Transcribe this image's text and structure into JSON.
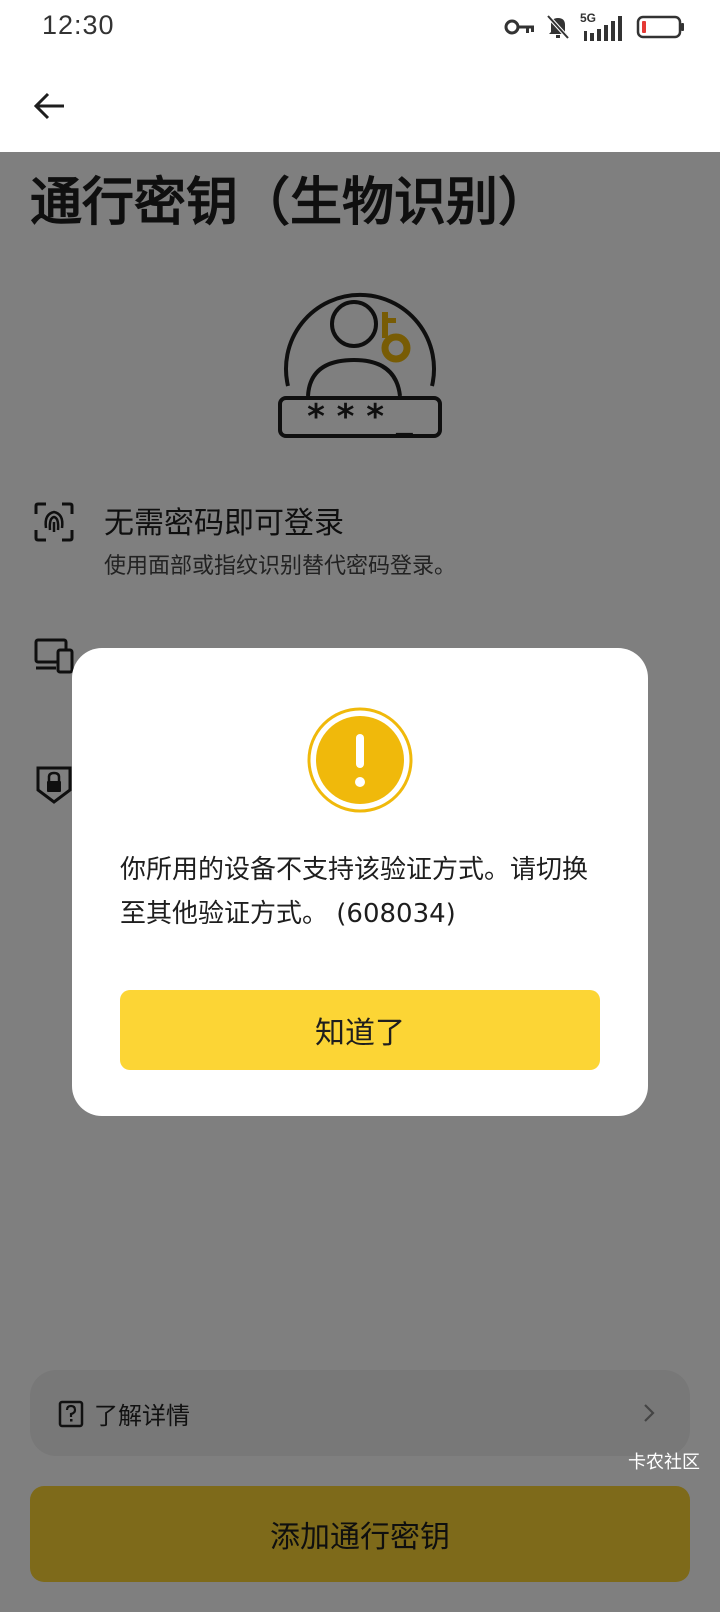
{
  "status_bar": {
    "time": "12:30",
    "network": "5G",
    "icons": [
      "key-icon",
      "bell-muted-icon",
      "signal-icon",
      "battery-icon"
    ]
  },
  "app_bar": {
    "back_icon": "arrow-left-icon"
  },
  "page": {
    "title": "通行密钥（生物识别）",
    "hero_icon": "passkey-user-key-icon",
    "hero_mask_text": "* * * _",
    "features": [
      {
        "icon": "face-scan-icon",
        "title": "无需密码即可登录",
        "desc": "使用面部或指纹识别替代密码登录。"
      },
      {
        "icon": "devices-icon",
        "title": "",
        "desc": ""
      },
      {
        "icon": "shield-lock-icon",
        "title": "",
        "desc": ""
      }
    ],
    "learn_more": {
      "label": "了解详情",
      "icon": "question-book-icon",
      "chevron": "chevron-right-icon"
    },
    "add_button": "添加通行密钥"
  },
  "dialog": {
    "icon": "warning-circle-icon",
    "message": "你所用的设备不支持该验证方式。请切换至其他验证方式。 (608034)",
    "ok_button": "知道了"
  },
  "watermark": "卡农社区",
  "colors": {
    "accent": "#FCD535",
    "warning": "#F0B90B",
    "overlay": "rgba(0,0,0,0.5)"
  }
}
